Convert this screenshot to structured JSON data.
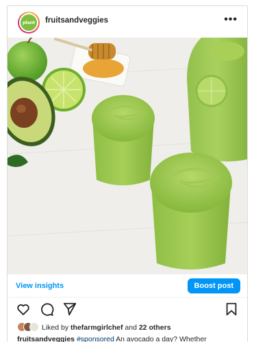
{
  "post": {
    "username": "fruitsandveggies",
    "avatar_text": "plant",
    "more_label": "•••",
    "image_alt": "Two glasses of green avocado smoothie with apple, avocado, lime and honey",
    "view_insights": "View insights",
    "boost_post": "Boost post",
    "likes": {
      "prefix": "Liked by",
      "user": "thefarmgirlchef",
      "middle": "and",
      "others": "22 others"
    },
    "caption": {
      "username": "fruitsandveggies",
      "hashtag": "#sponsored",
      "text": "An avocado a day? Whether"
    }
  },
  "icons": {
    "like": "heart-icon",
    "comment": "comment-icon",
    "share": "share-icon",
    "save": "bookmark-icon",
    "more": "more-icon"
  },
  "colors": {
    "accent": "#0095f6",
    "hashtag": "#00376b",
    "text": "#262626",
    "brand_green": "#7fbf3f"
  }
}
